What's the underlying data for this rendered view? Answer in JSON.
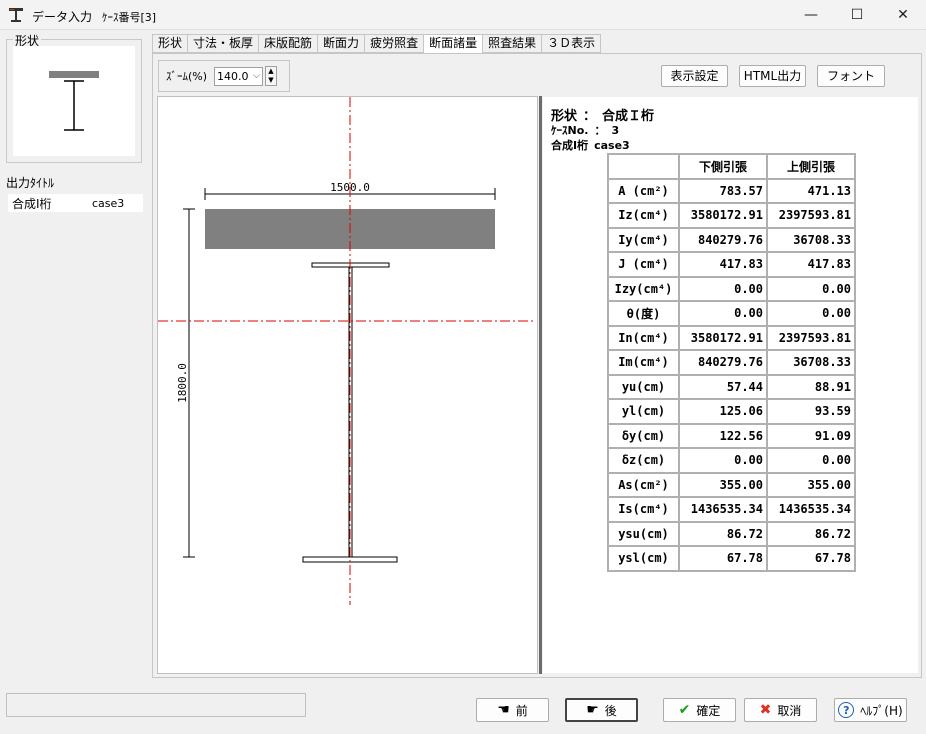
{
  "window": {
    "title": "データ入力",
    "case_label": "ｹｰｽ番号[3]",
    "minimize": "—",
    "maximize": "☐",
    "close": "✕"
  },
  "left_panel": {
    "shape_group_label": "形状",
    "output_title_label": "出力ﾀｲﾄﾙ",
    "output_row": {
      "name": "合成I桁",
      "value": "case3"
    }
  },
  "tabs": [
    {
      "label": "形状",
      "active": false
    },
    {
      "label": "寸法・板厚",
      "active": false
    },
    {
      "label": "床版配筋",
      "active": false
    },
    {
      "label": "断面力",
      "active": false
    },
    {
      "label": "疲労照査",
      "active": false
    },
    {
      "label": "断面諸量",
      "active": true
    },
    {
      "label": "照査結果",
      "active": false
    },
    {
      "label": "３Ｄ表示",
      "active": false
    }
  ],
  "toolbar": {
    "zoom_label": "ｽﾞｰﾑ(%)",
    "zoom_value": "140.0",
    "display_settings": "表示設定",
    "html_output": "HTML出力",
    "font": "フォント"
  },
  "drawing": {
    "width_dim": "1500.0",
    "height_dim": "1800.0"
  },
  "results": {
    "shape_key": "形状",
    "shape_sep": "：",
    "shape_value": "合成Ｉ桁",
    "case_key": "ｹｰｽNo.",
    "case_sep": "：",
    "case_value": "3",
    "title_name": "合成I桁",
    "title_value": "case3",
    "col_lower": "下側引張",
    "col_upper": "上側引張",
    "rows": [
      {
        "name": "A (cm²)",
        "lower": "783.57",
        "upper": "471.13"
      },
      {
        "name": "Iz(cm⁴)",
        "lower": "3580172.91",
        "upper": "2397593.81"
      },
      {
        "name": "Iy(cm⁴)",
        "lower": "840279.76",
        "upper": "36708.33"
      },
      {
        "name": "J (cm⁴)",
        "lower": "417.83",
        "upper": "417.83"
      },
      {
        "name": "Izy(cm⁴)",
        "lower": "0.00",
        "upper": "0.00"
      },
      {
        "name": "θ(度)",
        "lower": "0.00",
        "upper": "0.00"
      },
      {
        "name": "In(cm⁴)",
        "lower": "3580172.91",
        "upper": "2397593.81"
      },
      {
        "name": "Im(cm⁴)",
        "lower": "840279.76",
        "upper": "36708.33"
      },
      {
        "name": "yu(cm)",
        "lower": "57.44",
        "upper": "88.91"
      },
      {
        "name": "yl(cm)",
        "lower": "125.06",
        "upper": "93.59"
      },
      {
        "name": "δy(cm)",
        "lower": "122.56",
        "upper": "91.09"
      },
      {
        "name": "δz(cm)",
        "lower": "0.00",
        "upper": "0.00"
      },
      {
        "name": "As(cm²)",
        "lower": "355.00",
        "upper": "355.00"
      },
      {
        "name": "Is(cm⁴)",
        "lower": "1436535.34",
        "upper": "1436535.34"
      },
      {
        "name": "ysu(cm)",
        "lower": "86.72",
        "upper": "86.72"
      },
      {
        "name": "ysl(cm)",
        "lower": "67.78",
        "upper": "67.78"
      }
    ]
  },
  "buttons": {
    "prev": "前",
    "next": "後",
    "ok": "確定",
    "cancel": "取消",
    "help": "ﾍﾙﾌﾟ(H)"
  },
  "colors": {
    "slab": "#808080",
    "centerline": "#e00000",
    "ok_check": "#1a9a1a",
    "cancel_x": "#e03020"
  }
}
